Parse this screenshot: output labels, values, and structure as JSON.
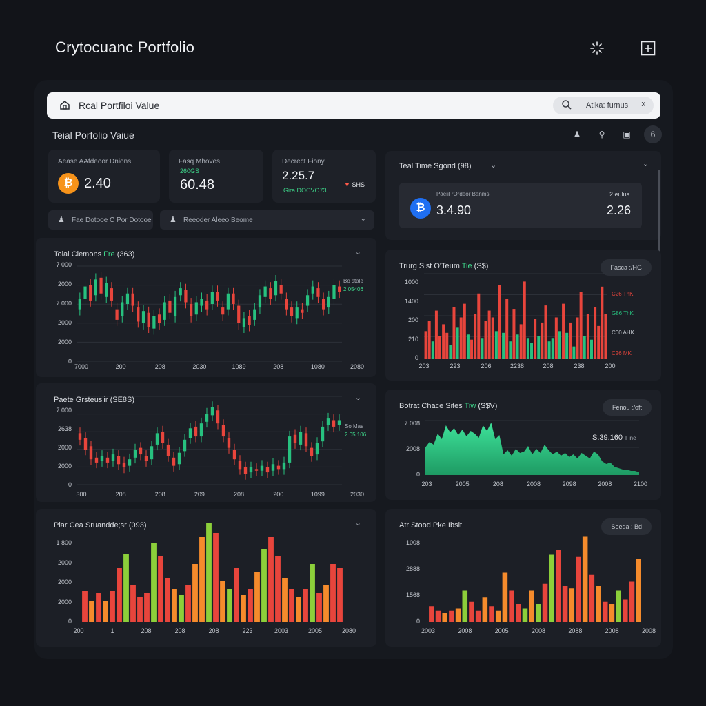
{
  "header": {
    "app_title": "Crytocuanc Portfolio",
    "icons": [
      "sparkle-icon",
      "add-icon"
    ]
  },
  "search": {
    "value": "Rcal Portfiloi Value",
    "pill_text": "Atika: furnus",
    "clear": "x"
  },
  "section": {
    "title": "Teial Porfolio Vaiue",
    "mini_icons": [
      "user-icon",
      "search-icon",
      "lock-icon",
      "settings-icon"
    ],
    "mini_glyphs": [
      "♟",
      "⚲",
      "▣",
      "6"
    ]
  },
  "stats": [
    {
      "label": "Aease AAfdeoor Dnions",
      "value": "2.40",
      "coin": "₿",
      "coin_color": "#f7931a"
    },
    {
      "label": "Fasq Mhoves",
      "sub": "260GS",
      "value": "60.48"
    },
    {
      "label": "Decrect Fiony",
      "value": "2.25.7",
      "sub": "Gira DOCVO73",
      "badge": "SHS"
    }
  ],
  "filters": [
    {
      "icon": "user-icon",
      "label": "Fae Dotooe C Por Dotooe"
    },
    {
      "icon": "user-icon",
      "label": "Reeoder Aleeo Beome"
    }
  ],
  "right_card": {
    "title": "Teal Time Sgorid (98)",
    "inner_label": "Paeiil rOrdeor Banms",
    "inner_right_label": "2 eulus",
    "coin": "₿",
    "coin_color": "#1f6ff2",
    "value_left": "3.4.90",
    "value_right": "2.26"
  },
  "panels": {
    "p1": {
      "title_a": "Toial Clemons ",
      "title_b": "Fre",
      "title_c": " (363)",
      "yticks": [
        "7 000",
        "2000",
        "7 000",
        "2000",
        "2000",
        "0"
      ],
      "xticks": [
        "7000",
        "200",
        "208",
        "2030",
        "1089",
        "208",
        "1080",
        "2080"
      ],
      "legend_a": "Bo stale",
      "legend_b": "2.05406"
    },
    "p2": {
      "title_a": "Trurg Sist O'Teum ",
      "title_b": "Tie",
      "title_c": " (S$)",
      "button": "Fasca :/HG",
      "yticks": [
        "1000",
        "1400",
        "200",
        "210",
        "0"
      ],
      "xticks": [
        "203",
        "223",
        "206",
        "2238",
        "208",
        "238",
        "200"
      ],
      "legend": [
        "C26 ThK",
        "G86 ThK",
        "C00 AHK",
        "C26 MK"
      ]
    },
    "p3": {
      "title_a": "Paete Grsteus'ir ",
      "title_b": "",
      "title_c": "(SE8S)",
      "yticks": [
        "7 000",
        "2638",
        "2000",
        "2000",
        "0"
      ],
      "xticks": [
        "300",
        "208",
        "208",
        "209",
        "208",
        "200",
        "1099",
        "2030"
      ],
      "legend_a": "So Mas",
      "legend_b": "2.05 106"
    },
    "p4": {
      "title_a": "Botrat Chace Sites ",
      "title_b": "Tiw",
      "title_c": " (S$V)",
      "button": "Fenou :/oft",
      "annotation": "S.39.160",
      "annotation_sub": "Fine",
      "yticks": [
        "7.008",
        "2008",
        "0"
      ],
      "xticks": [
        "203",
        "2005",
        "208",
        "2008",
        "2098",
        "2008",
        "2100"
      ]
    },
    "p5": {
      "title": "Plar Cea Sruandde;sr (093)",
      "yticks": [
        "1 800",
        "2000",
        "2000",
        "2000",
        "0"
      ],
      "xticks": [
        "200",
        "1",
        "208",
        "208",
        "208",
        "223",
        "2003",
        "2005",
        "2080"
      ]
    },
    "p6": {
      "title": "Atr Stood Pke Ibsit",
      "button": "Seeqa : Bd",
      "yticks": [
        "1008",
        "2888",
        "1568",
        "0"
      ],
      "xticks": [
        "2003",
        "2008",
        "2005",
        "2008",
        "2088",
        "2008",
        "2008"
      ]
    }
  },
  "colors": {
    "up": "#27c17f",
    "down": "#e8453c",
    "orange": "#f58b2c",
    "lime": "#8ccf3a",
    "teal_accent": "#3ed68a"
  },
  "chart_data": [
    {
      "type": "candlestick",
      "title": "Toial Clemons Fre (363)",
      "candles": [
        [
          3.0,
          3.6
        ],
        [
          3.6,
          4.3
        ],
        [
          4.4,
          3.5
        ],
        [
          3.8,
          4.7
        ],
        [
          4.8,
          3.9
        ],
        [
          3.7,
          4.5
        ],
        [
          4.2,
          3.5
        ],
        [
          3.0,
          2.4
        ],
        [
          2.6,
          3.4
        ],
        [
          3.3,
          3.9
        ],
        [
          3.9,
          3.2
        ],
        [
          3.1,
          2.3
        ],
        [
          2.2,
          2.9
        ],
        [
          2.8,
          2.0
        ],
        [
          1.9,
          2.6
        ],
        [
          2.7,
          2.2
        ],
        [
          2.4,
          3.4
        ],
        [
          3.5,
          2.8
        ],
        [
          2.6,
          3.7
        ],
        [
          3.8,
          4.2
        ],
        [
          4.1,
          3.4
        ],
        [
          3.3,
          2.6
        ],
        [
          2.7,
          3.4
        ],
        [
          3.2,
          3.6
        ],
        [
          3.5,
          3.0
        ],
        [
          3.3,
          4.0
        ],
        [
          4.0,
          3.5
        ],
        [
          3.1,
          2.7
        ],
        [
          3.0,
          3.9
        ],
        [
          3.9,
          3.3
        ],
        [
          3.2,
          2.2
        ],
        [
          2.0,
          2.5
        ],
        [
          2.6,
          2.1
        ],
        [
          2.4,
          3.0
        ],
        [
          3.1,
          3.8
        ],
        [
          3.7,
          4.3
        ],
        [
          4.2,
          3.6
        ],
        [
          3.8,
          4.6
        ],
        [
          4.4,
          3.9
        ],
        [
          3.6,
          3.0
        ],
        [
          3.1,
          2.6
        ],
        [
          2.5,
          3.1
        ],
        [
          3.0,
          2.8
        ],
        [
          3.2,
          3.8
        ],
        [
          3.9,
          4.3
        ],
        [
          4.2,
          3.7
        ],
        [
          3.6,
          3.0
        ],
        [
          3.1,
          3.7
        ],
        [
          3.6,
          4.4
        ],
        [
          4.3,
          4.0
        ]
      ],
      "ylim": [
        0,
        5.5
      ]
    },
    {
      "type": "bar",
      "title": "Trurg Sist O'Teum Tie (S$)",
      "values": [
        1.6,
        2.2,
        1.0,
        2.8,
        1.3,
        2.0,
        1.5,
        0.8,
        3.0,
        1.8,
        2.4,
        3.2,
        1.4,
        1.1,
        2.6,
        3.8,
        1.2,
        2.2,
        2.8,
        2.4,
        1.6,
        4.3,
        1.5,
        3.5,
        1.0,
        2.9,
        1.4,
        2.0,
        4.5,
        1.2,
        0.9,
        2.3,
        1.3,
        2.1,
        3.1,
        1.0,
        1.2,
        2.4,
        1.6,
        3.2,
        1.5,
        2.1,
        0.7,
        2.4,
        3.9,
        1.3,
        2.6,
        1.1,
        3.0,
        1.9,
        4.2,
        2.6
      ],
      "colors": [
        "down",
        "down",
        "up",
        "down",
        "down",
        "down",
        "down",
        "up",
        "down",
        "up",
        "down",
        "down",
        "up",
        "down",
        "down",
        "down",
        "up",
        "down",
        "down",
        "down",
        "up",
        "down",
        "up",
        "down",
        "up",
        "down",
        "up",
        "down",
        "down",
        "up",
        "up",
        "down",
        "up",
        "down",
        "down",
        "up",
        "up",
        "down",
        "up",
        "down",
        "up",
        "down",
        "up",
        "down",
        "down",
        "up",
        "down",
        "up",
        "down",
        "down",
        "down",
        "down"
      ],
      "ylim": [
        0,
        5
      ]
    },
    {
      "type": "candlestick",
      "title": "Paete Grsteus'ir (SE8S)",
      "candles": [
        [
          3.2,
          2.8
        ],
        [
          2.9,
          2.2
        ],
        [
          2.4,
          1.6
        ],
        [
          1.7,
          1.4
        ],
        [
          1.5,
          1.8
        ],
        [
          1.7,
          1.4
        ],
        [
          1.5,
          1.9
        ],
        [
          1.8,
          1.3
        ],
        [
          1.4,
          1.1
        ],
        [
          1.2,
          1.6
        ],
        [
          1.7,
          2.2
        ],
        [
          2.3,
          1.9
        ],
        [
          1.8,
          1.5
        ],
        [
          1.6,
          2.4
        ],
        [
          2.5,
          3.2
        ],
        [
          3.3,
          2.6
        ],
        [
          2.5,
          1.8
        ],
        [
          1.7,
          1.2
        ],
        [
          1.3,
          2.0
        ],
        [
          2.1,
          2.8
        ],
        [
          2.9,
          3.5
        ],
        [
          3.6,
          3.0
        ],
        [
          3.0,
          3.8
        ],
        [
          3.9,
          4.4
        ],
        [
          4.3,
          4.8
        ],
        [
          4.6,
          3.8
        ],
        [
          3.7,
          3.0
        ],
        [
          2.9,
          2.3
        ],
        [
          2.2,
          1.6
        ],
        [
          1.5,
          1.0
        ],
        [
          1.1,
          0.7
        ],
        [
          0.8,
          1.1
        ],
        [
          1.0,
          0.9
        ],
        [
          0.9,
          1.2
        ],
        [
          1.1,
          0.8
        ],
        [
          0.9,
          1.3
        ],
        [
          1.2,
          1.0
        ],
        [
          1.0,
          1.4
        ],
        [
          1.4,
          3.0
        ],
        [
          3.1,
          2.6
        ],
        [
          2.5,
          3.3
        ],
        [
          3.2,
          2.4
        ],
        [
          2.3,
          1.8
        ],
        [
          1.9,
          2.6
        ],
        [
          2.7,
          3.6
        ],
        [
          3.7,
          4.1
        ],
        [
          4.0,
          3.6
        ],
        [
          3.7,
          4.0
        ]
      ],
      "ylim": [
        0,
        5.5
      ]
    },
    {
      "type": "area",
      "title": "Botrat Chace Sites Tiw (S$V)",
      "values": [
        2.0,
        2.4,
        2.2,
        3.0,
        2.6,
        3.6,
        3.1,
        3.4,
        2.9,
        3.3,
        2.8,
        3.2,
        3.0,
        2.7,
        3.6,
        3.2,
        3.8,
        2.6,
        2.9,
        1.5,
        1.8,
        1.4,
        1.9,
        1.6,
        1.7,
        2.1,
        1.5,
        1.9,
        1.6,
        2.2,
        1.8,
        1.5,
        1.7,
        1.4,
        1.6,
        1.3,
        1.5,
        1.2,
        1.6,
        1.4,
        1.2,
        1.7,
        1.5,
        1.0,
        0.8,
        0.9,
        0.6,
        0.5,
        0.4,
        0.4,
        0.3,
        0.3,
        0.2
      ],
      "ylim": [
        0,
        4
      ]
    },
    {
      "type": "bar",
      "title": "Plar Cea Sruandde;sr (093)",
      "values": [
        1.5,
        1.0,
        1.4,
        1.0,
        1.5,
        2.6,
        3.3,
        1.8,
        1.2,
        1.4,
        3.8,
        3.2,
        2.1,
        1.6,
        1.3,
        1.8,
        2.8,
        4.1,
        4.8,
        4.3,
        2.0,
        1.6,
        2.6,
        1.3,
        1.6,
        2.4,
        3.5,
        4.1,
        3.2,
        2.1,
        1.6,
        1.2,
        1.6,
        2.8,
        1.4,
        1.8,
        2.8,
        2.6
      ],
      "colors": [
        "down",
        "orange",
        "down",
        "orange",
        "down",
        "down",
        "lime",
        "down",
        "down",
        "down",
        "lime",
        "down",
        "down",
        "orange",
        "lime",
        "down",
        "orange",
        "orange",
        "lime",
        "down",
        "orange",
        "lime",
        "down",
        "orange",
        "down",
        "orange",
        "lime",
        "down",
        "down",
        "orange",
        "down",
        "orange",
        "down",
        "lime",
        "down",
        "orange",
        "down",
        "down"
      ],
      "ylim": [
        0,
        5
      ]
    },
    {
      "type": "bar",
      "title": "Atr Stood Pke Ibsit",
      "values": [
        0.7,
        0.5,
        0.4,
        0.5,
        0.6,
        1.4,
        0.9,
        0.5,
        1.1,
        0.7,
        0.5,
        2.2,
        1.4,
        0.8,
        0.6,
        1.4,
        0.8,
        1.7,
        3.0,
        3.2,
        1.6,
        1.5,
        2.9,
        3.8,
        2.1,
        1.6,
        0.9,
        0.8,
        1.4,
        1.0,
        1.8,
        2.8
      ],
      "colors": [
        "down",
        "down",
        "orange",
        "down",
        "orange",
        "lime",
        "down",
        "down",
        "orange",
        "down",
        "orange",
        "orange",
        "down",
        "down",
        "lime",
        "orange",
        "lime",
        "down",
        "lime",
        "down",
        "down",
        "orange",
        "down",
        "orange",
        "down",
        "orange",
        "down",
        "orange",
        "lime",
        "down",
        "down",
        "orange"
      ],
      "ylim": [
        0,
        4
      ]
    }
  ]
}
